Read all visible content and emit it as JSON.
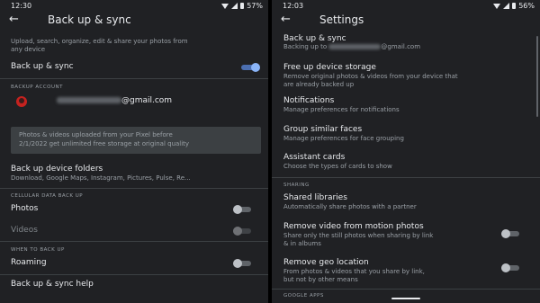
{
  "left": {
    "status": {
      "time": "12:30",
      "battery": "57%"
    },
    "title": "Back up & sync",
    "intro_line1": "Upload, search, organize, edit & share your photos from",
    "intro_line2": "any device",
    "backup_sync_label": "Back up & sync",
    "backup_account_header": "BACKUP ACCOUNT",
    "account_email_suffix": "@gmail.com",
    "info_line1": "Photos & videos uploaded from your Pixel before",
    "info_line2": "2/1/2022 get unlimited free storage at original quality",
    "device_folders_title": "Back up device folders",
    "device_folders_sub": "Download, Google Maps, Instagram, Pictures, Pulse, Re...",
    "cellular_header": "CELLULAR DATA BACK UP",
    "photos_label": "Photos",
    "videos_label": "Videos",
    "when_header": "WHEN TO BACK UP",
    "roaming_label": "Roaming",
    "help_label": "Back up & sync help"
  },
  "right": {
    "status": {
      "time": "12:03",
      "battery": "56%"
    },
    "title": "Settings",
    "items": [
      {
        "title": "Back up & sync",
        "sub": "Backing up to",
        "sub_suffix": "@gmail.com"
      },
      {
        "title": "Free up device storage",
        "sub": "Remove original photos & videos from your device that",
        "sub2": "are already backed up"
      },
      {
        "title": "Notifications",
        "sub": "Manage preferences for notifications"
      },
      {
        "title": "Group similar faces",
        "sub": "Manage preferences for face grouping"
      },
      {
        "title": "Assistant cards",
        "sub": "Choose the types of cards to show"
      }
    ],
    "sharing_header": "SHARING",
    "shared_libraries_title": "Shared libraries",
    "shared_libraries_sub": "Automatically share photos with a partner",
    "remove_video_title": "Remove video from motion photos",
    "remove_video_sub1": "Share only the still photos when sharing by link",
    "remove_video_sub2": "& in albums",
    "remove_geo_title": "Remove geo location",
    "remove_geo_sub1": "From photos & videos that you share by link,",
    "remove_geo_sub2": "but not by other means",
    "google_apps_header": "GOOGLE APPS"
  },
  "toggles": {
    "backup_sync": true,
    "photos": false,
    "videos": false,
    "roaming": false,
    "remove_video": false,
    "remove_geo": false
  },
  "colors": {
    "background": "#202124",
    "accent": "#8ab4f8",
    "text": "#e8eaed",
    "secondary": "#9aa0a6"
  },
  "icons": [
    "back-arrow-icon",
    "wifi-icon",
    "signal-icon",
    "battery-icon",
    "account-avatar"
  ]
}
